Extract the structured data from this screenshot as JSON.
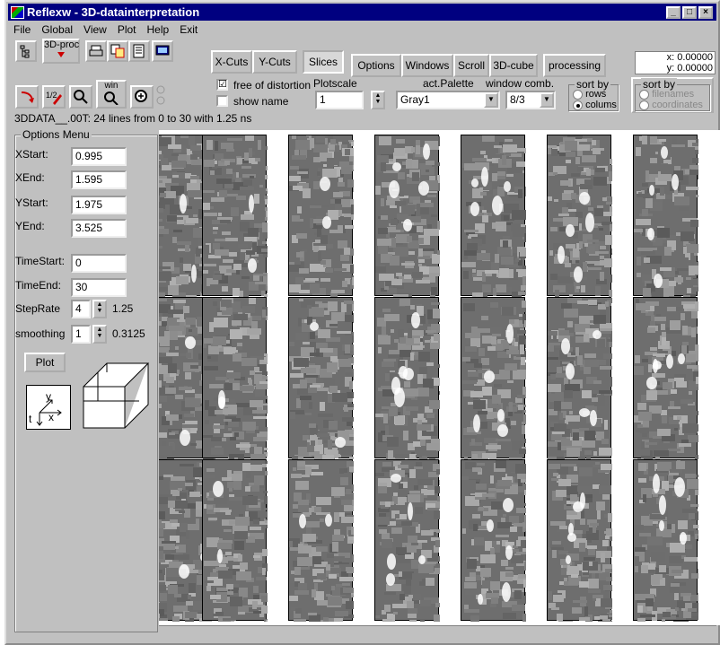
{
  "window": {
    "title": "Reflexw - 3D-datainterpretation",
    "min": "_",
    "max": "□",
    "close": "×"
  },
  "menu": [
    "File",
    "Global",
    "View",
    "Plot",
    "Help",
    "Exit"
  ],
  "toolbar": {
    "proc_label": "3D-proc",
    "win_label": "win",
    "xcuts": "X-Cuts",
    "ycuts": "Y-Cuts",
    "slices": "Slices",
    "options": "Options",
    "windows": "Windows",
    "scroll": "Scroll",
    "cube": "3D-cube",
    "processing": "processing"
  },
  "coords": {
    "x": "x: 0.00000",
    "y": "y: 0.00000"
  },
  "checkboxes": {
    "free_of_distortion": "free of distortion",
    "free_checked": "☑",
    "show_name": "show name"
  },
  "plotscale": {
    "label": "Plotscale",
    "value": "1"
  },
  "palette": {
    "label": "act.Palette",
    "value": "Gray1"
  },
  "window_comb": {
    "label": "window comb.",
    "value": "8/3"
  },
  "sort_by1": {
    "label": "sort by",
    "rows": "rows",
    "columns": "colums"
  },
  "sort_by2": {
    "label": "sort by",
    "filenames": "filenames",
    "coordinates": "coordinates"
  },
  "info_line": "3DDATA__.00T: 24 lines from 0 to 30 with 1.25 ns",
  "options_menu": {
    "title": "Options Menu",
    "xstart_label": "XStart:",
    "xstart": "0.995",
    "xend_label": "XEnd:",
    "xend": "1.595",
    "ystart_label": "YStart:",
    "ystart": "1.975",
    "yend_label": "YEnd:",
    "yend": "3.525",
    "timestart_label": "TimeStart:",
    "timestart": "0",
    "timeend_label": "TimeEnd:",
    "timeend": "30",
    "steprate_label": "StepRate",
    "steprate": "4",
    "steprate_val": "1.25",
    "smoothing_label": "smoothing",
    "smoothing": "1",
    "smoothing_val": "0.3125",
    "plot_button": "Plot",
    "axis_y": "y",
    "axis_x": "x",
    "axis_t": "t"
  },
  "slice_grid": {
    "rows": 3,
    "columns": 7,
    "colors": {
      "dark": "#6e6e6e",
      "light": "#b4b4b4",
      "bright": "#ffffff"
    }
  }
}
